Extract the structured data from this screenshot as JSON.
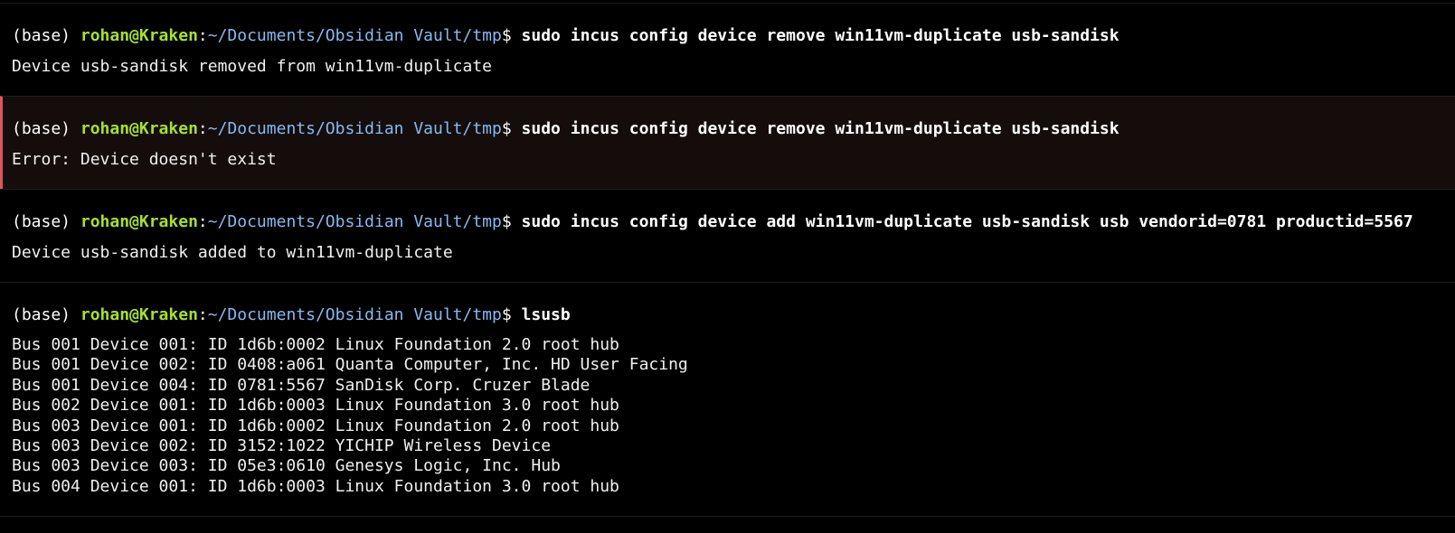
{
  "terminal": {
    "blocks": [
      {
        "status": "ok",
        "prompt": {
          "env": "(base) ",
          "user_host": "rohan@Kraken",
          "sep": ":",
          "path": "~/Documents/Obsidian Vault/tmp",
          "symbol": "$ ",
          "command": "sudo incus config device remove win11vm-duplicate usb-sandisk"
        },
        "output": [
          "Device usb-sandisk removed from win11vm-duplicate"
        ]
      },
      {
        "status": "error",
        "prompt": {
          "env": "(base) ",
          "user_host": "rohan@Kraken",
          "sep": ":",
          "path": "~/Documents/Obsidian Vault/tmp",
          "symbol": "$ ",
          "command": "sudo incus config device remove win11vm-duplicate usb-sandisk"
        },
        "output": [
          "Error: Device doesn't exist"
        ]
      },
      {
        "status": "ok",
        "prompt": {
          "env": "(base) ",
          "user_host": "rohan@Kraken",
          "sep": ":",
          "path": "~/Documents/Obsidian Vault/tmp",
          "symbol": "$ ",
          "command": "sudo incus config device add win11vm-duplicate usb-sandisk usb vendorid=0781 productid=5567"
        },
        "output": [
          "Device usb-sandisk added to win11vm-duplicate"
        ]
      },
      {
        "status": "ok",
        "prompt": {
          "env": "(base) ",
          "user_host": "rohan@Kraken",
          "sep": ":",
          "path": "~/Documents/Obsidian Vault/tmp",
          "symbol": "$ ",
          "command": "lsusb"
        },
        "output": [
          "Bus 001 Device 001: ID 1d6b:0002 Linux Foundation 2.0 root hub",
          "Bus 001 Device 002: ID 0408:a061 Quanta Computer, Inc. HD User Facing",
          "Bus 001 Device 004: ID 0781:5567 SanDisk Corp. Cruzer Blade",
          "Bus 002 Device 001: ID 1d6b:0003 Linux Foundation 3.0 root hub",
          "Bus 003 Device 001: ID 1d6b:0002 Linux Foundation 2.0 root hub",
          "Bus 003 Device 002: ID 3152:1022 YICHIP Wireless Device",
          "Bus 003 Device 003: ID 05e3:0610 Genesys Logic, Inc. Hub",
          "Bus 004 Device 001: ID 1d6b:0003 Linux Foundation 3.0 root hub"
        ]
      }
    ]
  }
}
